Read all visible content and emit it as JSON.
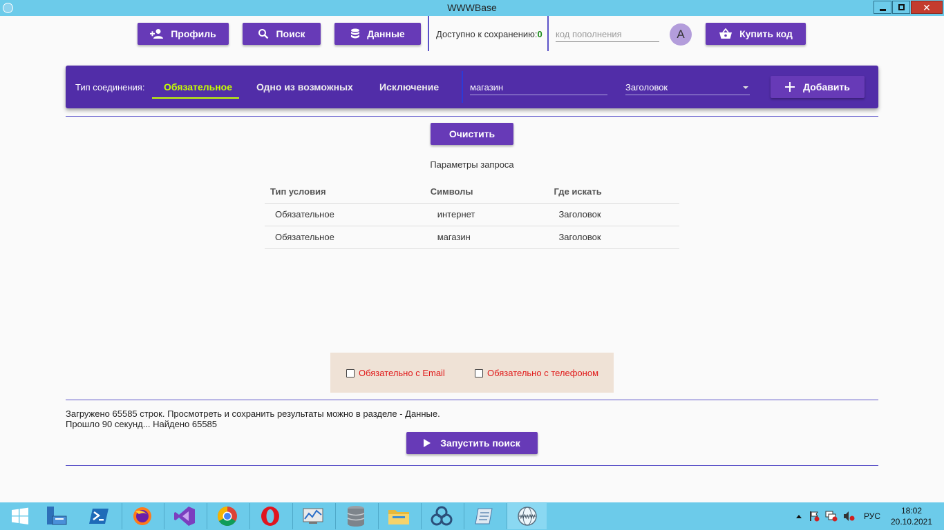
{
  "window": {
    "title": "WWWBase",
    "close_glyph": "✕"
  },
  "toolbar": {
    "profile_label": "Профиль",
    "search_label": "Поиск",
    "data_label": "Данные",
    "available_label": "Доступно к сохранению:",
    "available_count": "0",
    "code_placeholder": "код пополнения",
    "avatar_letter": "A",
    "buy_label": "Купить код"
  },
  "panel": {
    "connection_label": "Тип соединения:",
    "tabs": [
      {
        "label": "Обязательное",
        "active": true
      },
      {
        "label": "Одно из возможных",
        "active": false
      },
      {
        "label": "Исключение",
        "active": false
      }
    ],
    "query_value": "магазин",
    "field_select_value": "Заголовок",
    "add_label": "Добавить"
  },
  "clear_label": "Очистить",
  "params": {
    "title": "Параметры запроса",
    "headers": [
      "Тип условия",
      "Символы",
      "Где искать"
    ],
    "rows": [
      [
        "Обязательное",
        "интернет",
        "Заголовок"
      ],
      [
        "Обязательное",
        "магазин",
        "Заголовок"
      ]
    ]
  },
  "filters": {
    "email_label": "Обязательно с Email",
    "phone_label": "Обязательно с телефоном",
    "label_color": "#e01a1a"
  },
  "status": {
    "line1": "Загружено 65585 строк. Просмотреть и сохранить результаты можно в разделе - Данные.",
    "line2": "Прошло 90 секунд... Найдено 65585"
  },
  "run_label": "Запустить поиск",
  "colors": {
    "accent": "#673ab7",
    "panel": "#512da8",
    "active_tab": "#c6ff00",
    "titlebar": "#6ccbea"
  },
  "taskbar": {
    "items": [
      "start-icon",
      "server-manager-icon",
      "powershell-icon",
      "firefox-icon",
      "visual-studio-icon",
      "chrome-icon",
      "opera-icon",
      "performance-monitor-icon",
      "database-icon",
      "file-explorer-icon",
      "network-app-icon",
      "notepad-icon",
      "wwwbase-icon"
    ],
    "language": "РУС",
    "time": "18:02",
    "date": "20.10.2021"
  }
}
